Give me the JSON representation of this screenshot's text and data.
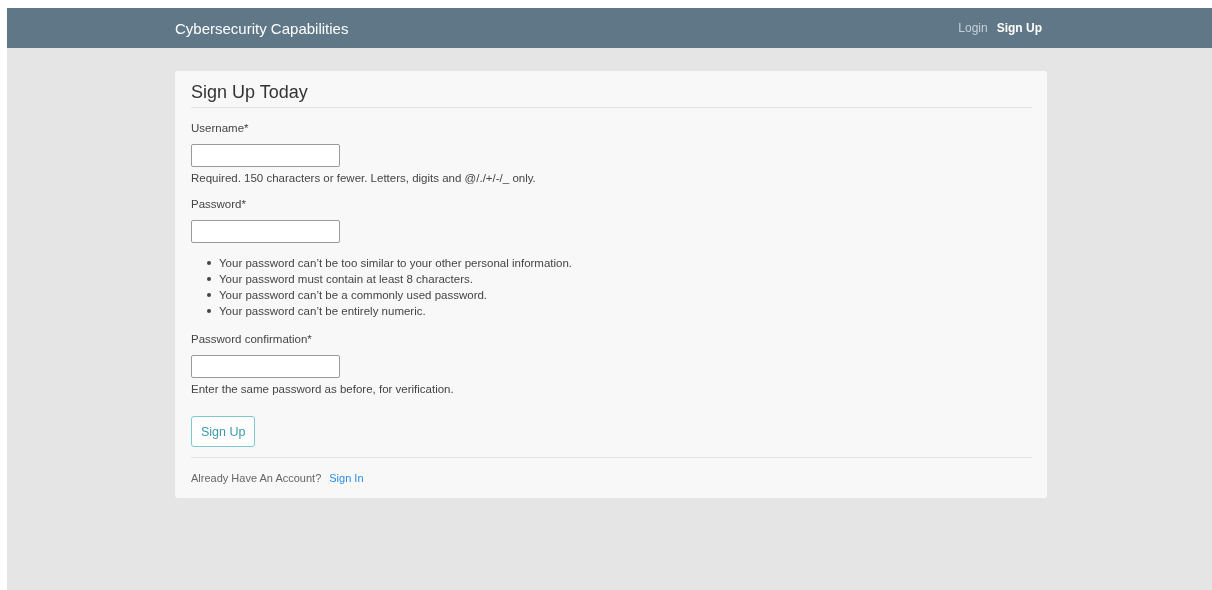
{
  "navbar": {
    "brand": "Cybersecurity Capabilities",
    "links": [
      {
        "label": "Login",
        "selected": false
      },
      {
        "label": "Sign Up",
        "selected": true
      }
    ]
  },
  "form": {
    "title": "Sign Up Today",
    "fields": [
      {
        "label": "Username*",
        "help": "Required. 150 characters or fewer. Letters, digits and @/./+/-/_ only."
      },
      {
        "label": "Password*",
        "help_items": [
          "Your password can’t be too similar to your other personal information.",
          "Your password must contain at least 8 characters.",
          "Your password can’t be a commonly used password.",
          "Your password can’t be entirely numeric."
        ]
      },
      {
        "label": "Password confirmation*",
        "help": "Enter the same password as before, for verification."
      }
    ],
    "submit": "Sign Up",
    "footer": {
      "text": "Already Have An Account?",
      "link": "Sign In"
    }
  }
}
